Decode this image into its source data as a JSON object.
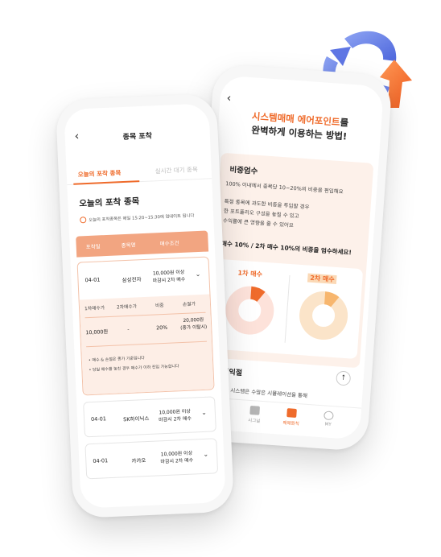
{
  "colors": {
    "accent": "#ef6b2b",
    "table_header": "#f2a581",
    "soft_bg": "#fdf1ea"
  },
  "back_phone": {
    "title_highlight": "시스템매매 에어포인트",
    "title_rest": "를",
    "title_line2": "완벽하게 이용하는 방법!",
    "section1": "비중엄수",
    "lines": [
      "100% 이내에서 종목당 10~20%의 비중을 편입해요",
      "특정 종목에 과도한 비중을 투입할 경우",
      "한 포트폴리오 구성을 놓칠 수 있고",
      "수익률에 큰 영향을 줄 수 있어요"
    ],
    "strong_line": "매수 10% / 2차 매수 10%의 비중을 엄수하세요!",
    "buy1_label": "1차 매수",
    "buy1_num": "1차",
    "buy2_label": "2차 매수",
    "buy2_num": "2차",
    "donut1_pct": "10%",
    "donut2_pct": "10%",
    "donut1_fraction": 0.1,
    "donut2_fraction": 0.1,
    "section2": "원칙익절",
    "up_icon": "arrow-up-icon",
    "foot": "포인트 시스템은 수많은 시뮬레이션을 통해",
    "nav": [
      {
        "label": "",
        "icon": "home-icon"
      },
      {
        "label": "시그널",
        "icon": "signal-icon"
      },
      {
        "label": "매매원칙",
        "icon": "document-icon"
      },
      {
        "label": "MY",
        "icon": "user-icon"
      }
    ]
  },
  "front_phone": {
    "back_icon": "‹",
    "header": "종목 포착",
    "tab_active": "오늘의 포착 종목",
    "tab_inactive": "실시간 대기 종목",
    "title": "오늘의 포착 종목",
    "notice": "오늘의 포착종목은 매일 15:20~15:30에 업데이트 됩니다",
    "columns": [
      "포착일",
      "종목명",
      "매수조건"
    ],
    "rows": [
      {
        "date": "04-01",
        "name": "삼성전자",
        "cond1": "10,000원 이상",
        "cond2": "마감시 2차 매수"
      },
      {
        "date": "04-01",
        "name": "SK하이닉스",
        "cond1": "10,000원 이상",
        "cond2": "마감시 2차 매수"
      },
      {
        "date": "04-01",
        "name": "카카오",
        "cond1": "10,000원 이상",
        "cond2": "마감시 2차 매수"
      }
    ],
    "detail": {
      "headers": [
        "1차매수가",
        "2차매수가",
        "비중",
        "손절가"
      ],
      "buy1": "10,000원",
      "buy2": "-",
      "weight": "20%",
      "stop1": "20,000원",
      "stop2": "(종가 이탈시)",
      "notes": [
        "• 매수 & 손절은 종가 기준입니다",
        "• 당일 매수를 놓친 경우 매수가 이하 진입 가능합니다"
      ]
    }
  }
}
